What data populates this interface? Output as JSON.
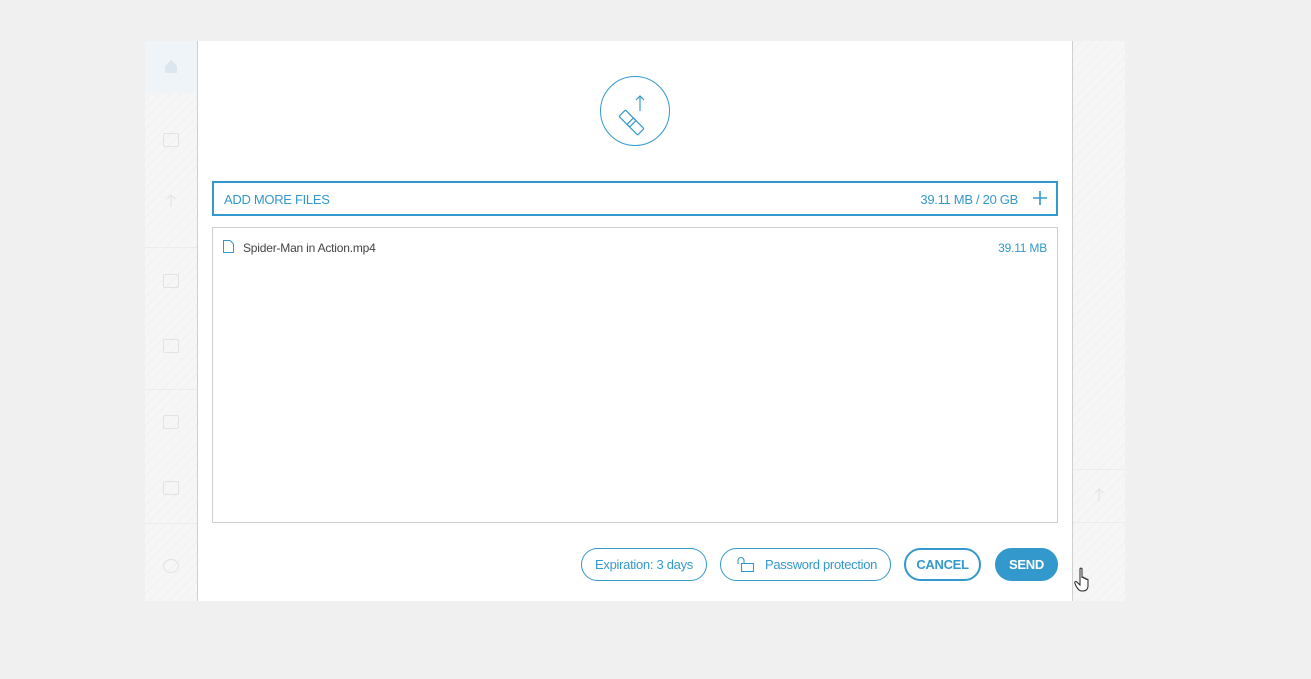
{
  "upload": {
    "add_label": "ADD MORE FILES",
    "quota": "39.11 MB / 20 GB"
  },
  "files": [
    {
      "name": "Spider-Man in Action.mp4",
      "size": "39.11 MB"
    }
  ],
  "actions": {
    "expiration": "Expiration: 3 days",
    "password": "Password protection",
    "cancel": "CANCEL",
    "send": "SEND"
  },
  "colors": {
    "accent": "#3399cc",
    "border": "#cfcfcf"
  },
  "icons": {
    "logo": "chain-link-upload-icon",
    "add": "plus-icon",
    "file": "file-icon",
    "lock": "unlocked-padlock-icon"
  }
}
